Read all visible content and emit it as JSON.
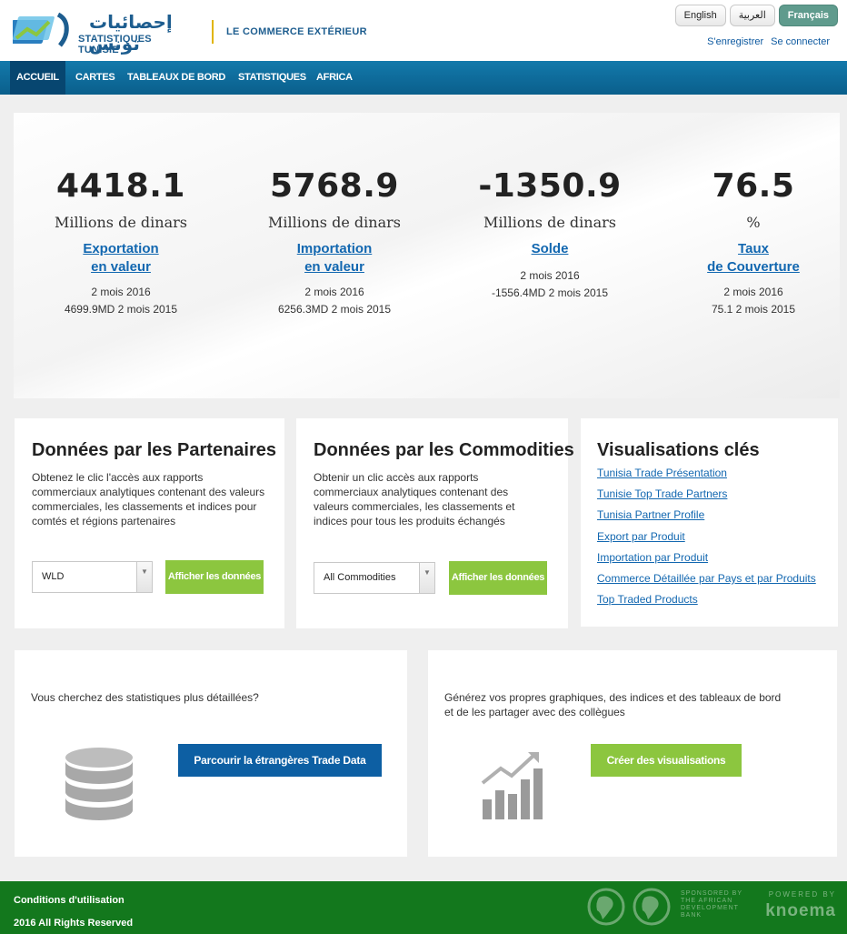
{
  "header": {
    "logo_arabic": "إحصائيات تونس",
    "logo_text": "STATISTIQUES TUNISIE",
    "section_title": "LE COMMERCE EXTÉRIEUR",
    "languages": [
      "English",
      "العربية",
      "Français"
    ],
    "active_language": "Français",
    "register": "S'enregistrer",
    "login": "Se connecter"
  },
  "nav": {
    "items": [
      "ACCUEIL",
      "CARTES",
      "TABLEAUX DE BORD",
      "STATISTIQUES",
      "AFRICA"
    ],
    "active": "ACCUEIL"
  },
  "kpis": [
    {
      "value": "4418.1",
      "unit": "Millions de dinars",
      "link_line1": "Exportation",
      "link_line2": "en valeur",
      "period": "2 mois 2016",
      "previous": "4699.9MD 2 mois 2015"
    },
    {
      "value": "5768.9",
      "unit": "Millions de dinars",
      "link_line1": "Importation",
      "link_line2": "en valeur",
      "period": "2 mois 2016",
      "previous": "6256.3MD 2 mois 2015"
    },
    {
      "value": "-1350.9",
      "unit": "Millions de dinars",
      "link_line1": "Solde",
      "link_line2": "",
      "period": "2 mois 2016",
      "previous": "-1556.4MD 2 mois 2015"
    },
    {
      "value": "76.5",
      "unit": "%",
      "link_line1": "Taux",
      "link_line2": "de Couverture",
      "period": "2 mois 2016",
      "previous": "75.1 2 mois 2015"
    }
  ],
  "partners": {
    "title": "Données par les Partenaires",
    "description": "Obtenez le clic l'accès aux rapports commerciaux analytiques contenant des valeurs commerciales, les classements et indices pour comtés et régions partenaires",
    "select_value": "WLD",
    "button": "Afficher les données"
  },
  "commodities": {
    "title": "Données par les Commodities",
    "description": "Obtenir un clic accès aux rapports commerciaux analytiques contenant des valeurs commerciales, les classements et indices pour tous les produits échangés",
    "select_value": "All Commodities",
    "button": "Afficher les données"
  },
  "visualisations": {
    "title": "Visualisations clés",
    "links": [
      "Tunisia Trade Présentation",
      "Tunisie Top Trade Partners",
      "Tunisia Partner Profile",
      "Export par Produit",
      "Importation par Produit",
      "Commerce Détaillée par Pays et par Produits",
      "Top Traded Products"
    ]
  },
  "browse": {
    "text": "Vous cherchez des statistiques plus détaillées?",
    "button": "Parcourir la étrangères Trade Data",
    "icon": "database-icon"
  },
  "create": {
    "text": "Générez vos propres graphiques, des indices et des tableaux de bord et de les partager avec des collègues",
    "button": "Créer des visualisations",
    "icon": "bar-chart-icon"
  },
  "footer": {
    "terms": "Conditions d'utilisation",
    "rights": "2016 All Rights Reserved",
    "sponsor_lines": [
      "SPONSORED BY",
      "THE AFRICAN",
      "DEVELOPMENT",
      "BANK"
    ],
    "powered_by": "POWERED BY",
    "brand": "knoema"
  },
  "colors": {
    "nav": "#0a5f8c",
    "link": "#1267b0",
    "green_button": "#8cc63f",
    "blue_button": "#0d5fa3",
    "footer": "#13781d"
  }
}
